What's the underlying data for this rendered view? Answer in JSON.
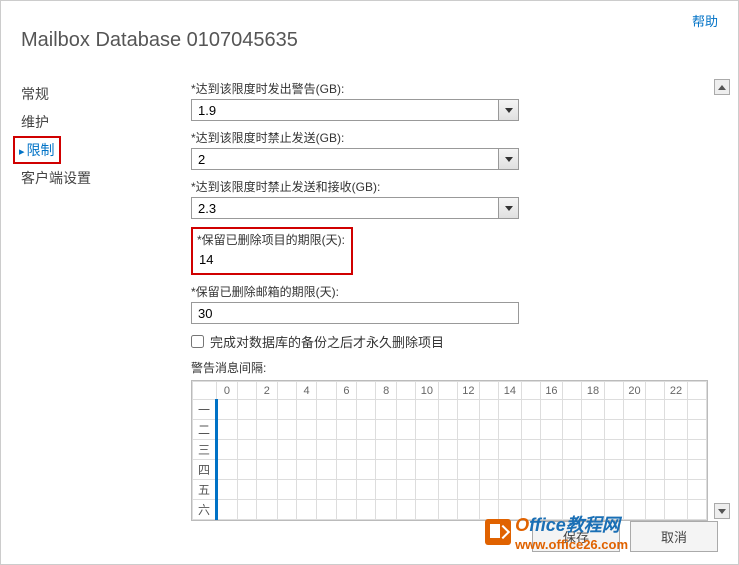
{
  "help_link": "帮助",
  "title": "Mailbox Database 0107045635",
  "sidebar": {
    "items": [
      {
        "label": "常规"
      },
      {
        "label": "维护"
      },
      {
        "label": "限制"
      },
      {
        "label": "客户端设置"
      }
    ],
    "active_index": 2
  },
  "fields": {
    "warn_label": "*达到该限度时发出警告(GB):",
    "warn_value": "1.9",
    "prohibit_send_label": "*达到该限度时禁止发送(GB):",
    "prohibit_send_value": "2",
    "prohibit_sr_label": "*达到该限度时禁止发送和接收(GB):",
    "prohibit_sr_value": "2.3",
    "keep_deleted_items_label": "*保留已删除项目的期限(天):",
    "keep_deleted_items_value": "14",
    "keep_deleted_mailbox_label": "*保留已删除邮箱的期限(天):",
    "keep_deleted_mailbox_value": "30",
    "checkbox_label": "完成对数据库的备份之后才永久删除项目",
    "checkbox_checked": false,
    "schedule_label": "警告消息间隔:"
  },
  "schedule": {
    "hours": [
      "0",
      "",
      "2",
      "",
      "4",
      "",
      "6",
      "",
      "8",
      "",
      "10",
      "",
      "12",
      "",
      "14",
      "",
      "16",
      "",
      "18",
      "",
      "20",
      "",
      "22",
      ""
    ],
    "days": [
      "一",
      "二",
      "三",
      "四",
      "五",
      "六"
    ]
  },
  "footer": {
    "save": "保存",
    "cancel": "取消"
  },
  "watermark": {
    "text1": "O",
    "text2": "ffice教程网",
    "url": "www.office26.com"
  }
}
